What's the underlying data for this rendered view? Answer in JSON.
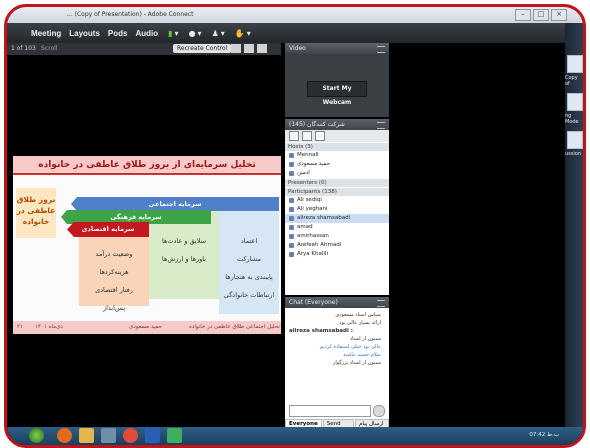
{
  "window": {
    "title": "... (Copy of Presentation) - Adobe Connect",
    "buttons": [
      "–",
      "□",
      "×"
    ]
  },
  "menubar": {
    "items": [
      "Meeting",
      "Layouts",
      "Pods",
      "Audio"
    ],
    "mic_glyph": "▮",
    "cam_glyph": "●",
    "user_glyph": "♟",
    "hand_glyph": "✋",
    "dropdown_glyph": "▾"
  },
  "share": {
    "page_label": "1 of 103",
    "mode_label": "Scroll",
    "action_button": "Recreate Control",
    "slide": {
      "title": "تحلیل سرمایه‌ای از بروز طلاق عاطفی در خانواده",
      "left_box": "بروز طلاق عاطفی در خانواده",
      "arrow_social": "سرمایه اجتماعی",
      "arrow_cultural": "سرمایه فرهنگی",
      "arrow_economic": "سرمایه اقتصادی",
      "social_items": [
        "اعتماد",
        "مشارکت",
        "پایبندی به هنجارها",
        "ارتباطات خانوادگی"
      ],
      "cultural_items": [
        "سلایق و عادت‌ها",
        "باورها و ارزش‌ها"
      ],
      "economic_items": [
        "وضعیت درآمد",
        "هزینه‌کردها",
        "رفتار اقتصادی",
        "پس‌انداز"
      ],
      "footer_left": "دی‌ماه ۱۴۰۱",
      "footer_center": "حمید مسعودی",
      "footer_right": "تحلیل اجتماعی طلاق عاطفی در خانواده",
      "page_num": "۲۱"
    }
  },
  "video_pod": {
    "title": "Video",
    "start_webcam": "Start My Webcam"
  },
  "attendee_pod": {
    "title": "شرکت کنندگان (145)",
    "hosts_header": "Hosts (3)",
    "hosts": [
      "Mennall",
      "حمید مسعودی",
      "ادمین"
    ],
    "presenters_header": "Presenters (0)",
    "participants_header": "Participants (138)",
    "participants": [
      "Ali sediqi",
      "Ali yeghani",
      "alireza shamsabadi",
      "amad",
      "amirhassan",
      "Arefeeh Ahmadi",
      "Arya Khalili"
    ]
  },
  "chat_pod": {
    "title": "Chat (Everyone)",
    "messages": [
      "سپاس استاد مسعودی",
      "ارائه بسیار عالی بود",
      "alireza shamsabadi :",
      "ممنون از استاد",
      "عالی بود خیلی استفاده کردیم",
      "سلام خسته نباشید",
      "ممنون از استاد بزرگوار"
    ],
    "tabs": [
      "Everyone",
      "Send post",
      "ارسال پیام به"
    ]
  },
  "layout_strip": {
    "labels": [
      "Copy of",
      "ng Mode",
      "ussion"
    ]
  },
  "taskbar": {
    "clock": "07:42 ب.ظ"
  }
}
